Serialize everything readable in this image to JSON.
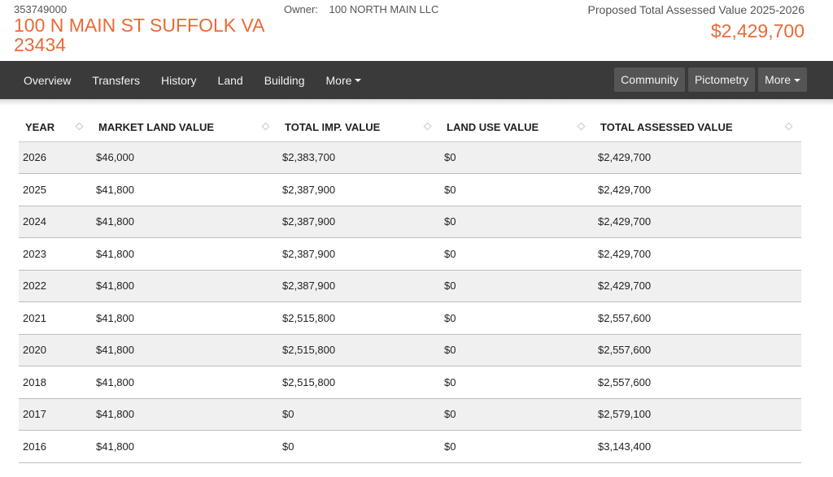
{
  "header": {
    "parcel_id": "353749000",
    "address": "100 N MAIN ST SUFFOLK VA 23434",
    "owner_label": "Owner:",
    "owner_name": "100 NORTH MAIN LLC",
    "assessed_label": "Proposed Total Assessed Value 2025-2026",
    "assessed_value": "$2,429,700"
  },
  "nav": {
    "items": [
      "Overview",
      "Transfers",
      "History",
      "Land",
      "Building",
      "More"
    ],
    "right_buttons": [
      "Community",
      "Pictometry",
      "More"
    ]
  },
  "colors": {
    "accent": "#e96a35",
    "navbar": "#3a3a3a",
    "nav_button": "#555555"
  },
  "table": {
    "headers": [
      "YEAR",
      "MARKET LAND VALUE",
      "TOTAL IMP. VALUE",
      "LAND USE VALUE",
      "TOTAL ASSESSED VALUE"
    ],
    "rows": [
      [
        "2026",
        "$46,000",
        "$2,383,700",
        "$0",
        "$2,429,700"
      ],
      [
        "2025",
        "$41,800",
        "$2,387,900",
        "$0",
        "$2,429,700"
      ],
      [
        "2024",
        "$41,800",
        "$2,387,900",
        "$0",
        "$2,429,700"
      ],
      [
        "2023",
        "$41,800",
        "$2,387,900",
        "$0",
        "$2,429,700"
      ],
      [
        "2022",
        "$41,800",
        "$2,387,900",
        "$0",
        "$2,429,700"
      ],
      [
        "2021",
        "$41,800",
        "$2,515,800",
        "$0",
        "$2,557,600"
      ],
      [
        "2020",
        "$41,800",
        "$2,515,800",
        "$0",
        "$2,557,600"
      ],
      [
        "2018",
        "$41,800",
        "$2,515,800",
        "$0",
        "$2,557,600"
      ],
      [
        "2017",
        "$41,800",
        "$0",
        "$0",
        "$2,579,100"
      ],
      [
        "2016",
        "$41,800",
        "$0",
        "$0",
        "$3,143,400"
      ]
    ]
  }
}
